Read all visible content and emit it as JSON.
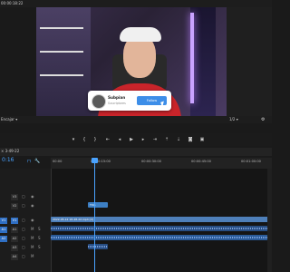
{
  "monitor": {
    "timecode_top": "00:00:18:22",
    "fit_label": "Encajar",
    "resolution_label": "1/2"
  },
  "subscribe_card": {
    "channel_name": "Subpian",
    "handle": "Suscriptores",
    "button_label": "Follow"
  },
  "transport": {
    "buttons": [
      "mark-in",
      "mark-out",
      "go-to-in",
      "step-back",
      "play",
      "step-forward",
      "go-to-out",
      "lift",
      "extract",
      "export-frame",
      "settings"
    ]
  },
  "timeline": {
    "tab_label": "3-49-22",
    "current_time": "0:16",
    "ruler_labels": [
      "00:00",
      "00:00:15:00",
      "00:00:30:00",
      "00:00:45:00",
      "00:01:00:00"
    ],
    "tracks": {
      "v3": "V3",
      "v2": "V2",
      "v1": "V1",
      "a1": "A1",
      "a2": "A2",
      "a3": "A3",
      "a4": "A4"
    },
    "clips": {
      "title_clip": "Title",
      "video_clip": "2022-05-12 18-48-22.mp4 [V]"
    }
  },
  "colors": {
    "accent": "#4aa3ff",
    "follow_button": "#3d8ee8",
    "shirt": "#c9242a"
  }
}
